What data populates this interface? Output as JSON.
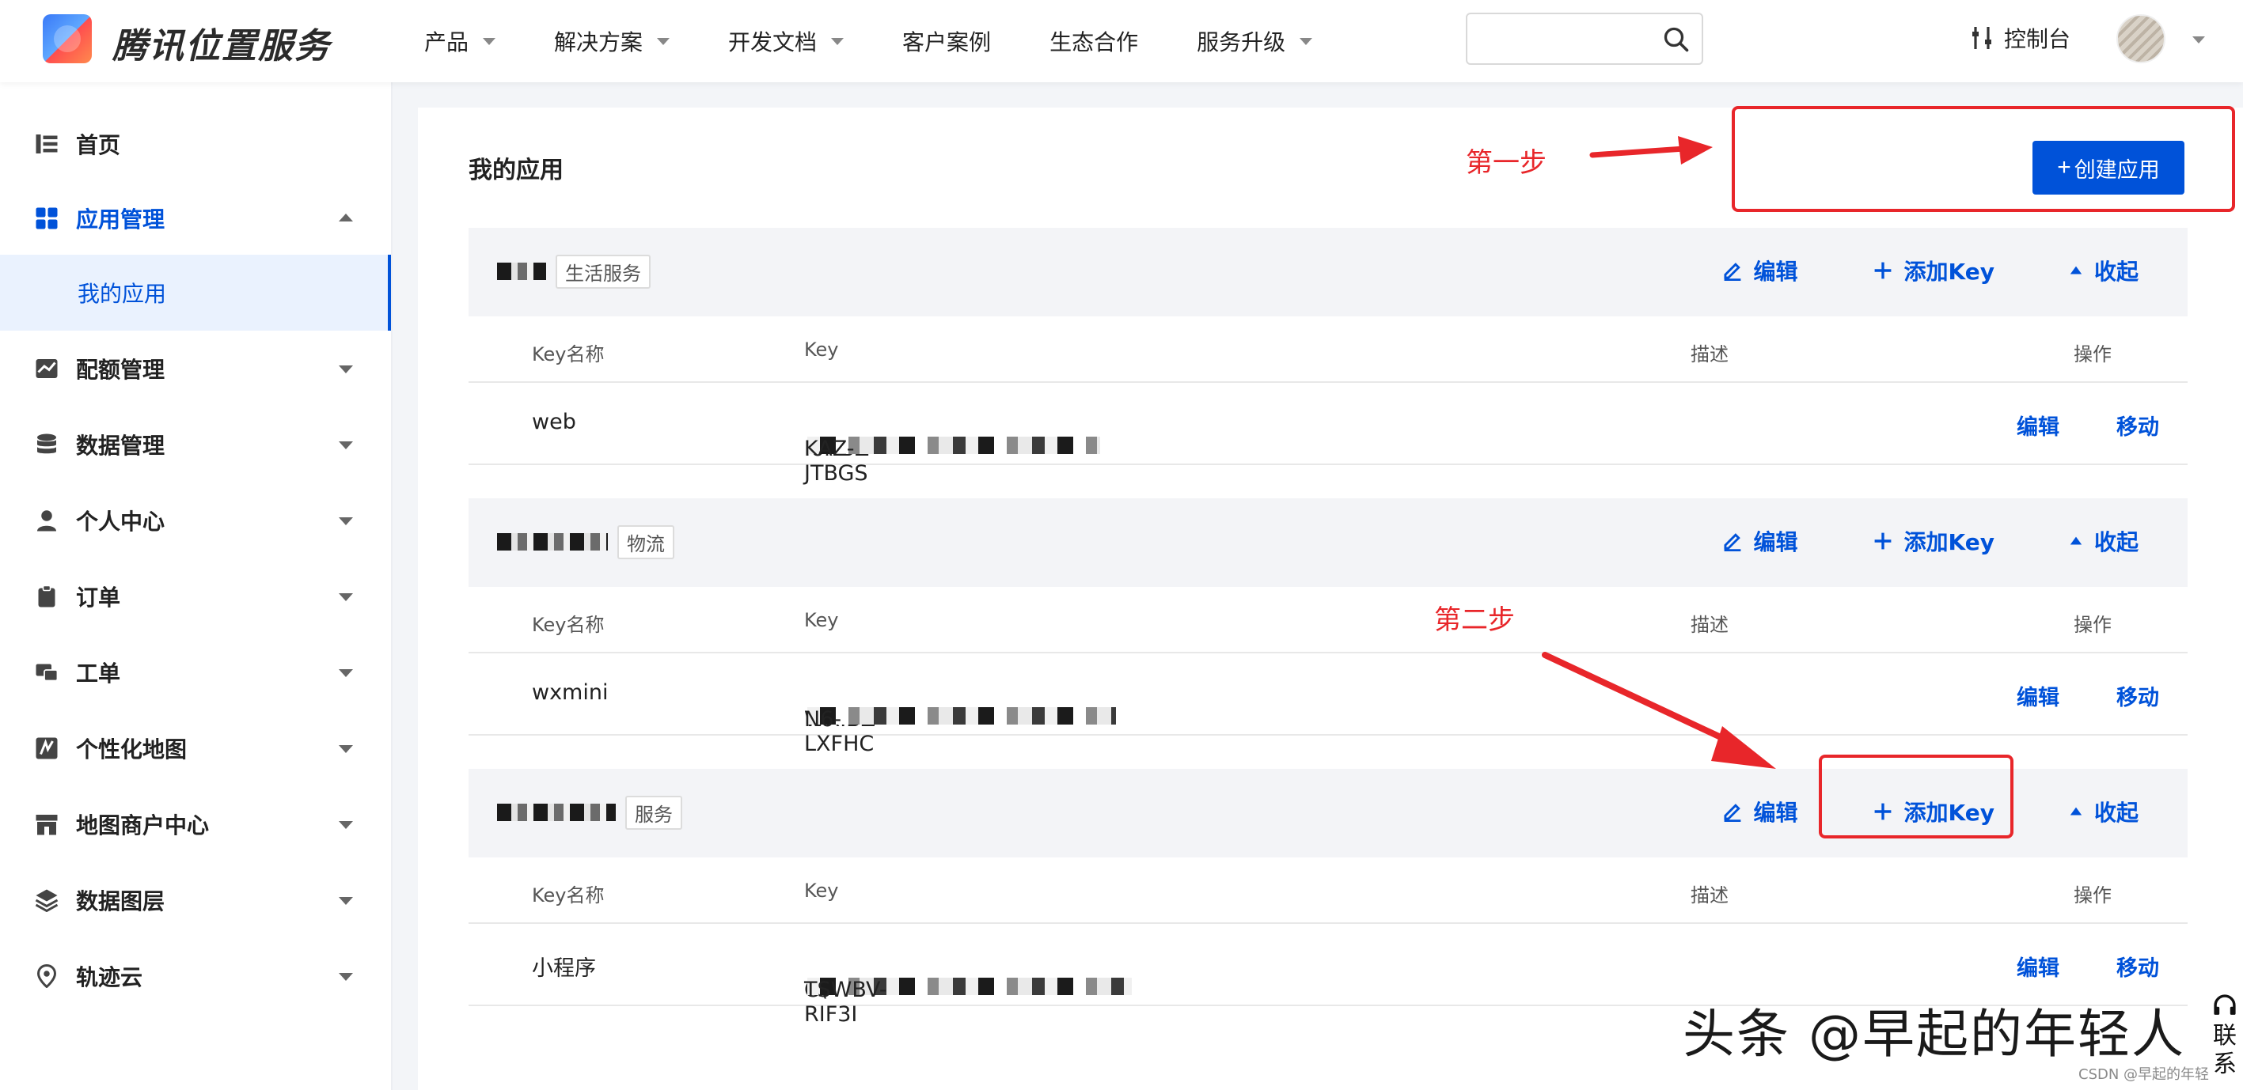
{
  "header": {
    "brand": "腾讯位置服务",
    "nav": [
      {
        "label": "产品",
        "dropdown": true
      },
      {
        "label": "解决方案",
        "dropdown": true
      },
      {
        "label": "开发文档",
        "dropdown": true
      },
      {
        "label": "客户案例",
        "dropdown": false
      },
      {
        "label": "生态合作",
        "dropdown": false
      },
      {
        "label": "服务升级",
        "dropdown": true
      }
    ],
    "search_placeholder": "",
    "console_label": "控制台"
  },
  "sidebar": {
    "items": [
      {
        "label": "首页",
        "icon": "list-icon"
      },
      {
        "label": "应用管理",
        "icon": "grid-icon",
        "active": true,
        "expanded": true
      },
      {
        "label": "配额管理",
        "icon": "chart-icon"
      },
      {
        "label": "数据管理",
        "icon": "database-icon"
      },
      {
        "label": "个人中心",
        "icon": "user-icon"
      },
      {
        "label": "订单",
        "icon": "clipboard-icon"
      },
      {
        "label": "工单",
        "icon": "ticket-icon"
      },
      {
        "label": "个性化地图",
        "icon": "map-style-icon"
      },
      {
        "label": "地图商户中心",
        "icon": "store-icon"
      },
      {
        "label": "数据图层",
        "icon": "layers-icon"
      },
      {
        "label": "轨迹云",
        "icon": "location-pin-icon"
      }
    ],
    "sub_item": "我的应用"
  },
  "main": {
    "title": "我的应用",
    "create_button": "创建应用",
    "columns": [
      "Key名称",
      "Key",
      "描述",
      "操作"
    ],
    "actions": {
      "edit": "编辑",
      "add_key": "添加Key",
      "collapse": "收起"
    },
    "row_ops": {
      "edit": "编辑",
      "move": "移动"
    },
    "apps": [
      {
        "tag": "生活服务",
        "keys": [
          {
            "name": "web",
            "key_prefix": "I6NBZ",
            "key_suffix": "KAZ-JTBGS",
            "desc": ""
          }
        ]
      },
      {
        "tag": "物流",
        "keys": [
          {
            "name": "wxmini",
            "key_prefix": "WXIBZ",
            "key_suffix": "N6-LXFHC",
            "desc": ""
          }
        ]
      },
      {
        "tag": "服务",
        "keys": [
          {
            "name": "小程序",
            "key_prefix": "C\\",
            "key_suffix": "TSWBV-RIF3I",
            "desc": ""
          }
        ]
      }
    ]
  },
  "annotations": {
    "step1": "第一步",
    "step2": "第二步"
  },
  "watermark": "头条 @早起的年轻人",
  "csdn": "CSDN @早起的年轻",
  "contact": "联系",
  "colors": {
    "accent": "#0052d9",
    "annotation": "#e8262a"
  }
}
